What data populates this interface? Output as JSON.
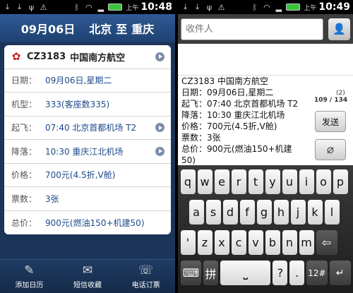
{
  "left": {
    "statusbar": {
      "ampm": "上午",
      "time": "10:48"
    },
    "route": {
      "date": "09月06日",
      "from": "北京",
      "sep": "至",
      "to": "重庆"
    },
    "card": {
      "flight_code": "CZ3183",
      "airline": "中国南方航空",
      "rows": [
        {
          "label": "日期：",
          "value": "09月06日,星期二"
        },
        {
          "label": "机型：",
          "value": "333(客座数335)"
        },
        {
          "label": "起飞：",
          "value": "07:40 北京首都机场  T2"
        },
        {
          "label": "降落：",
          "value": "10:30 重庆江北机场"
        },
        {
          "label": "价格：",
          "value": "700元(4.5折,V舱)"
        },
        {
          "label": "票数：",
          "value": "3张"
        },
        {
          "label": "总价：",
          "value": "900元(燃油150+机建50)"
        }
      ]
    },
    "bottom_bar": [
      {
        "label": "添加日历",
        "icon": "calendar-edit-icon"
      },
      {
        "label": "短信收藏",
        "icon": "envelope-icon"
      },
      {
        "label": "电话订票",
        "icon": "phone-icon"
      }
    ]
  },
  "right": {
    "statusbar": {
      "ampm": "上午",
      "time": "10:49"
    },
    "recipient_placeholder": "收件人",
    "message_text": "CZ3183 中国南方航空\n日期：09月06日,星期二\n起飞：07:40 北京首都机场  T2\n降落：10:30 重庆江北机场\n价格：700元(4.5折,V舱)\n票数：3张\n总价：900元(燃油150+机建50)",
    "counter_small": "(2)",
    "counter": "109 / 134",
    "send_label": "发送",
    "keyboard": {
      "row1": [
        "q",
        "w",
        "e",
        "r",
        "t",
        "y",
        "u",
        "i",
        "o",
        "p"
      ],
      "row2": [
        "a",
        "s",
        "d",
        "f",
        "g",
        "h",
        "j",
        "k",
        "l"
      ],
      "row3": [
        "'",
        "z",
        "x",
        "c",
        "v",
        "b",
        "n",
        "m",
        "⇦"
      ],
      "row4_pinyin": "拼",
      "row4_punct": "?",
      "row4_dot": ".",
      "row4_num": "12#",
      "enter": "↵"
    }
  },
  "colors": {
    "accent_blue": "#1d4a8a",
    "header": "#2f5a94"
  }
}
